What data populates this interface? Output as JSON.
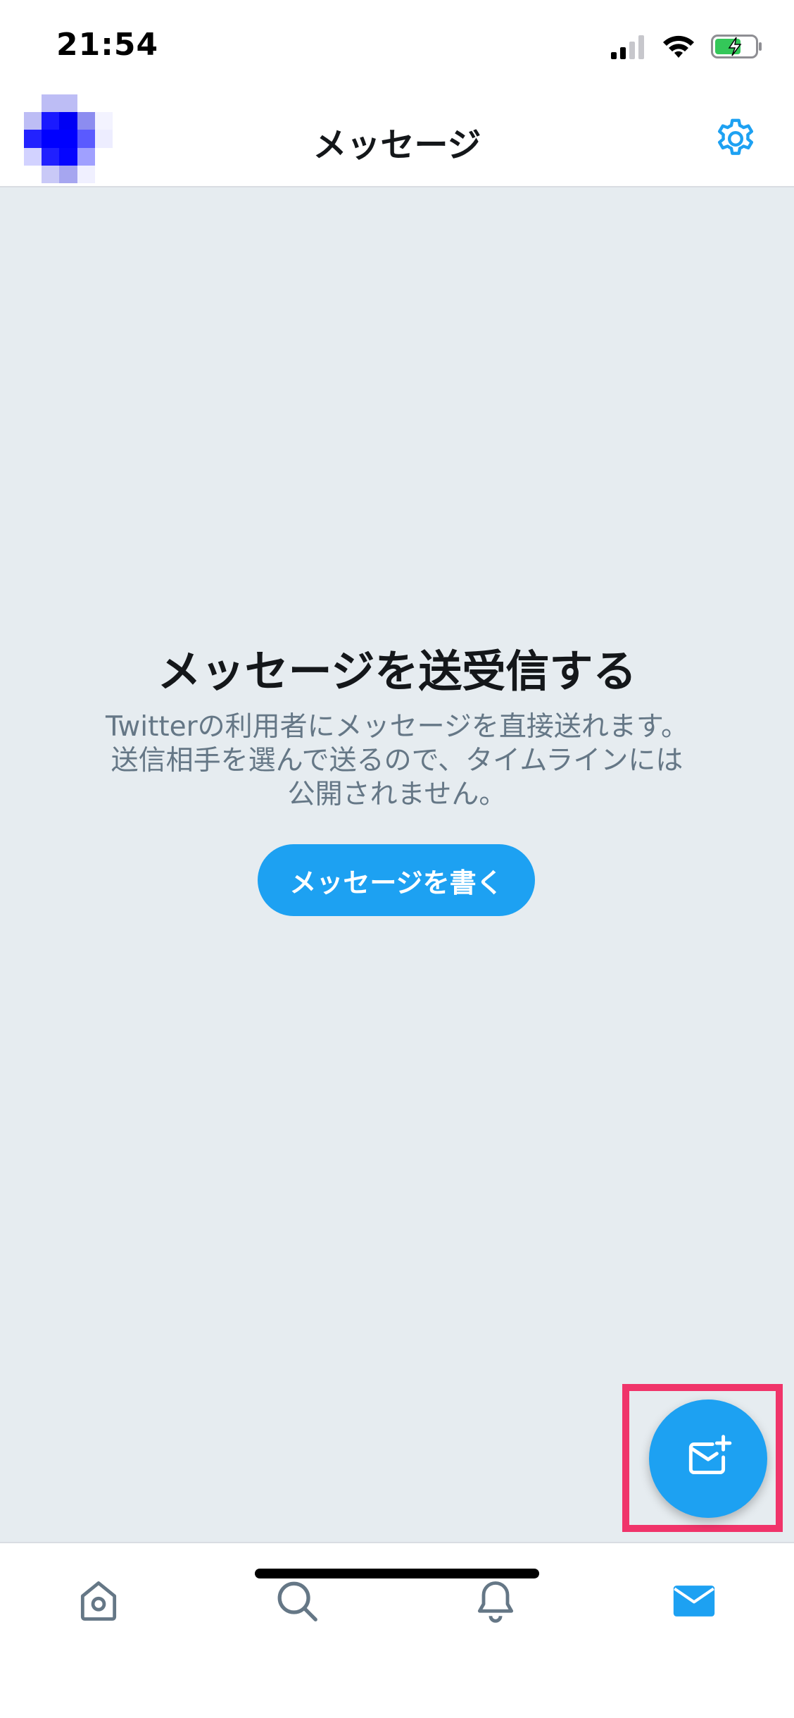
{
  "status_bar": {
    "time": "21:54",
    "signal_icon": "signal-icon",
    "wifi_icon": "wifi-icon",
    "battery_icon": "battery-charging-icon"
  },
  "header": {
    "title": "メッセージ",
    "settings_icon": "gear-icon",
    "avatar": "pixelated-profile-avatar"
  },
  "empty_state": {
    "title": "メッセージを送受信する",
    "description_lines": [
      "Twitterの利用者にメッセージを直接送れます。",
      "送信相手を選んで送るので、タイムラインには",
      "公開されません。"
    ],
    "button_label": "メッセージを書く"
  },
  "fab": {
    "icon": "new-message-icon"
  },
  "tabs": [
    {
      "icon": "home-icon"
    },
    {
      "icon": "search-icon"
    },
    {
      "icon": "bell-icon"
    },
    {
      "icon": "mail-icon",
      "active": true
    }
  ],
  "colors": {
    "accent": "#1da1f2",
    "background": "#e6ecf0",
    "highlight": "#f0346a",
    "secondary_text": "#657786",
    "icon_inactive": "#657786"
  }
}
